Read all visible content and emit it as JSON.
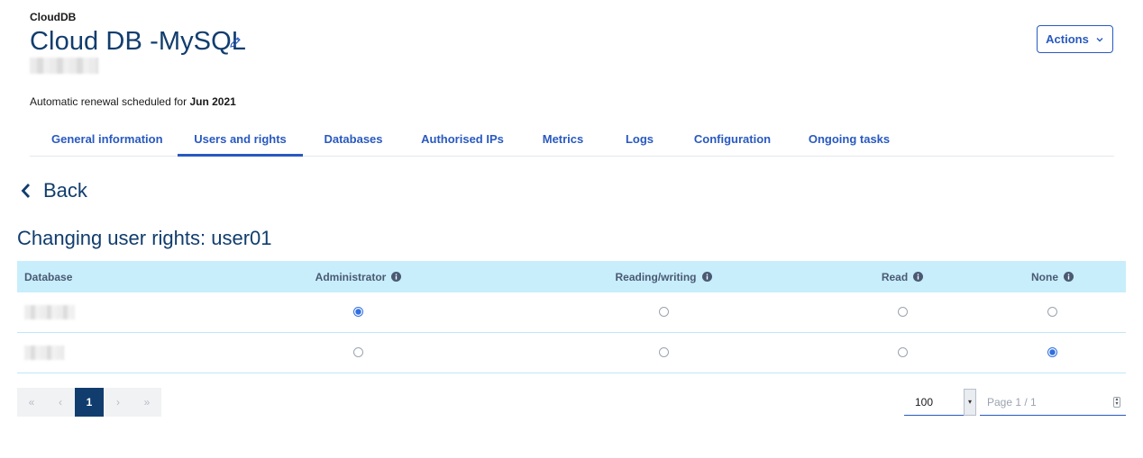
{
  "header": {
    "service_type": "CloudDB",
    "title": "Cloud DB -MySQL",
    "renewal_prefix": "Automatic renewal scheduled for ",
    "renewal_date": "Jun 2021",
    "actions_label": "Actions"
  },
  "tabs": [
    {
      "label": "General information",
      "active": false
    },
    {
      "label": "Users and rights",
      "active": true
    },
    {
      "label": "Databases",
      "active": false
    },
    {
      "label": "Authorised IPs",
      "active": false
    },
    {
      "label": "Metrics",
      "active": false
    },
    {
      "label": "Logs",
      "active": false
    },
    {
      "label": "Configuration",
      "active": false
    },
    {
      "label": "Ongoing tasks",
      "active": false
    }
  ],
  "back_label": "Back",
  "section_title": "Changing user rights: user01",
  "table": {
    "columns": [
      "Database",
      "Administrator",
      "Reading/writing",
      "Read",
      "None"
    ],
    "rows": [
      {
        "database": "",
        "selected": "Administrator"
      },
      {
        "database": "",
        "selected": "None"
      }
    ]
  },
  "pagination": {
    "first": "«",
    "prev": "‹",
    "current": "1",
    "next": "›",
    "last": "»",
    "per_page": "100",
    "page_placeholder": "Page 1 / 1"
  },
  "colors": {
    "primary": "#2859C0",
    "title": "#113D6E",
    "table_header_bg": "#c8eefb"
  }
}
